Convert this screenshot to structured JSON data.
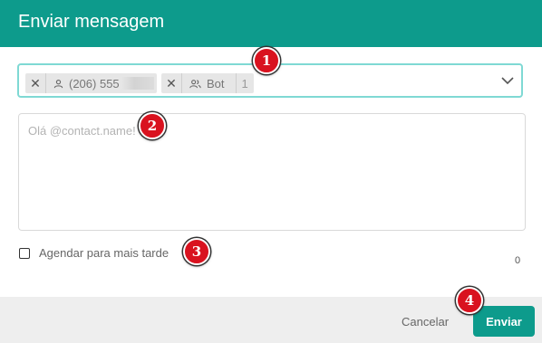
{
  "dialog": {
    "title": "Enviar mensagem"
  },
  "recipients": {
    "chips": [
      {
        "icon": "person-icon",
        "label": "(206) 555"
      },
      {
        "icon": "group-icon",
        "label": "Bot",
        "count": "1"
      }
    ]
  },
  "message": {
    "placeholder": "Olá @contact.name!",
    "char_count": "0"
  },
  "schedule": {
    "label": "Agendar para mais tarde",
    "checked": false
  },
  "footer": {
    "cancel_label": "Cancelar",
    "send_label": "Enviar"
  },
  "annotations": [
    "1",
    "2",
    "3",
    "4"
  ],
  "colors": {
    "primary": "#0d9b8c",
    "focus_border": "#7fd9d4",
    "badge": "#d9121f"
  }
}
